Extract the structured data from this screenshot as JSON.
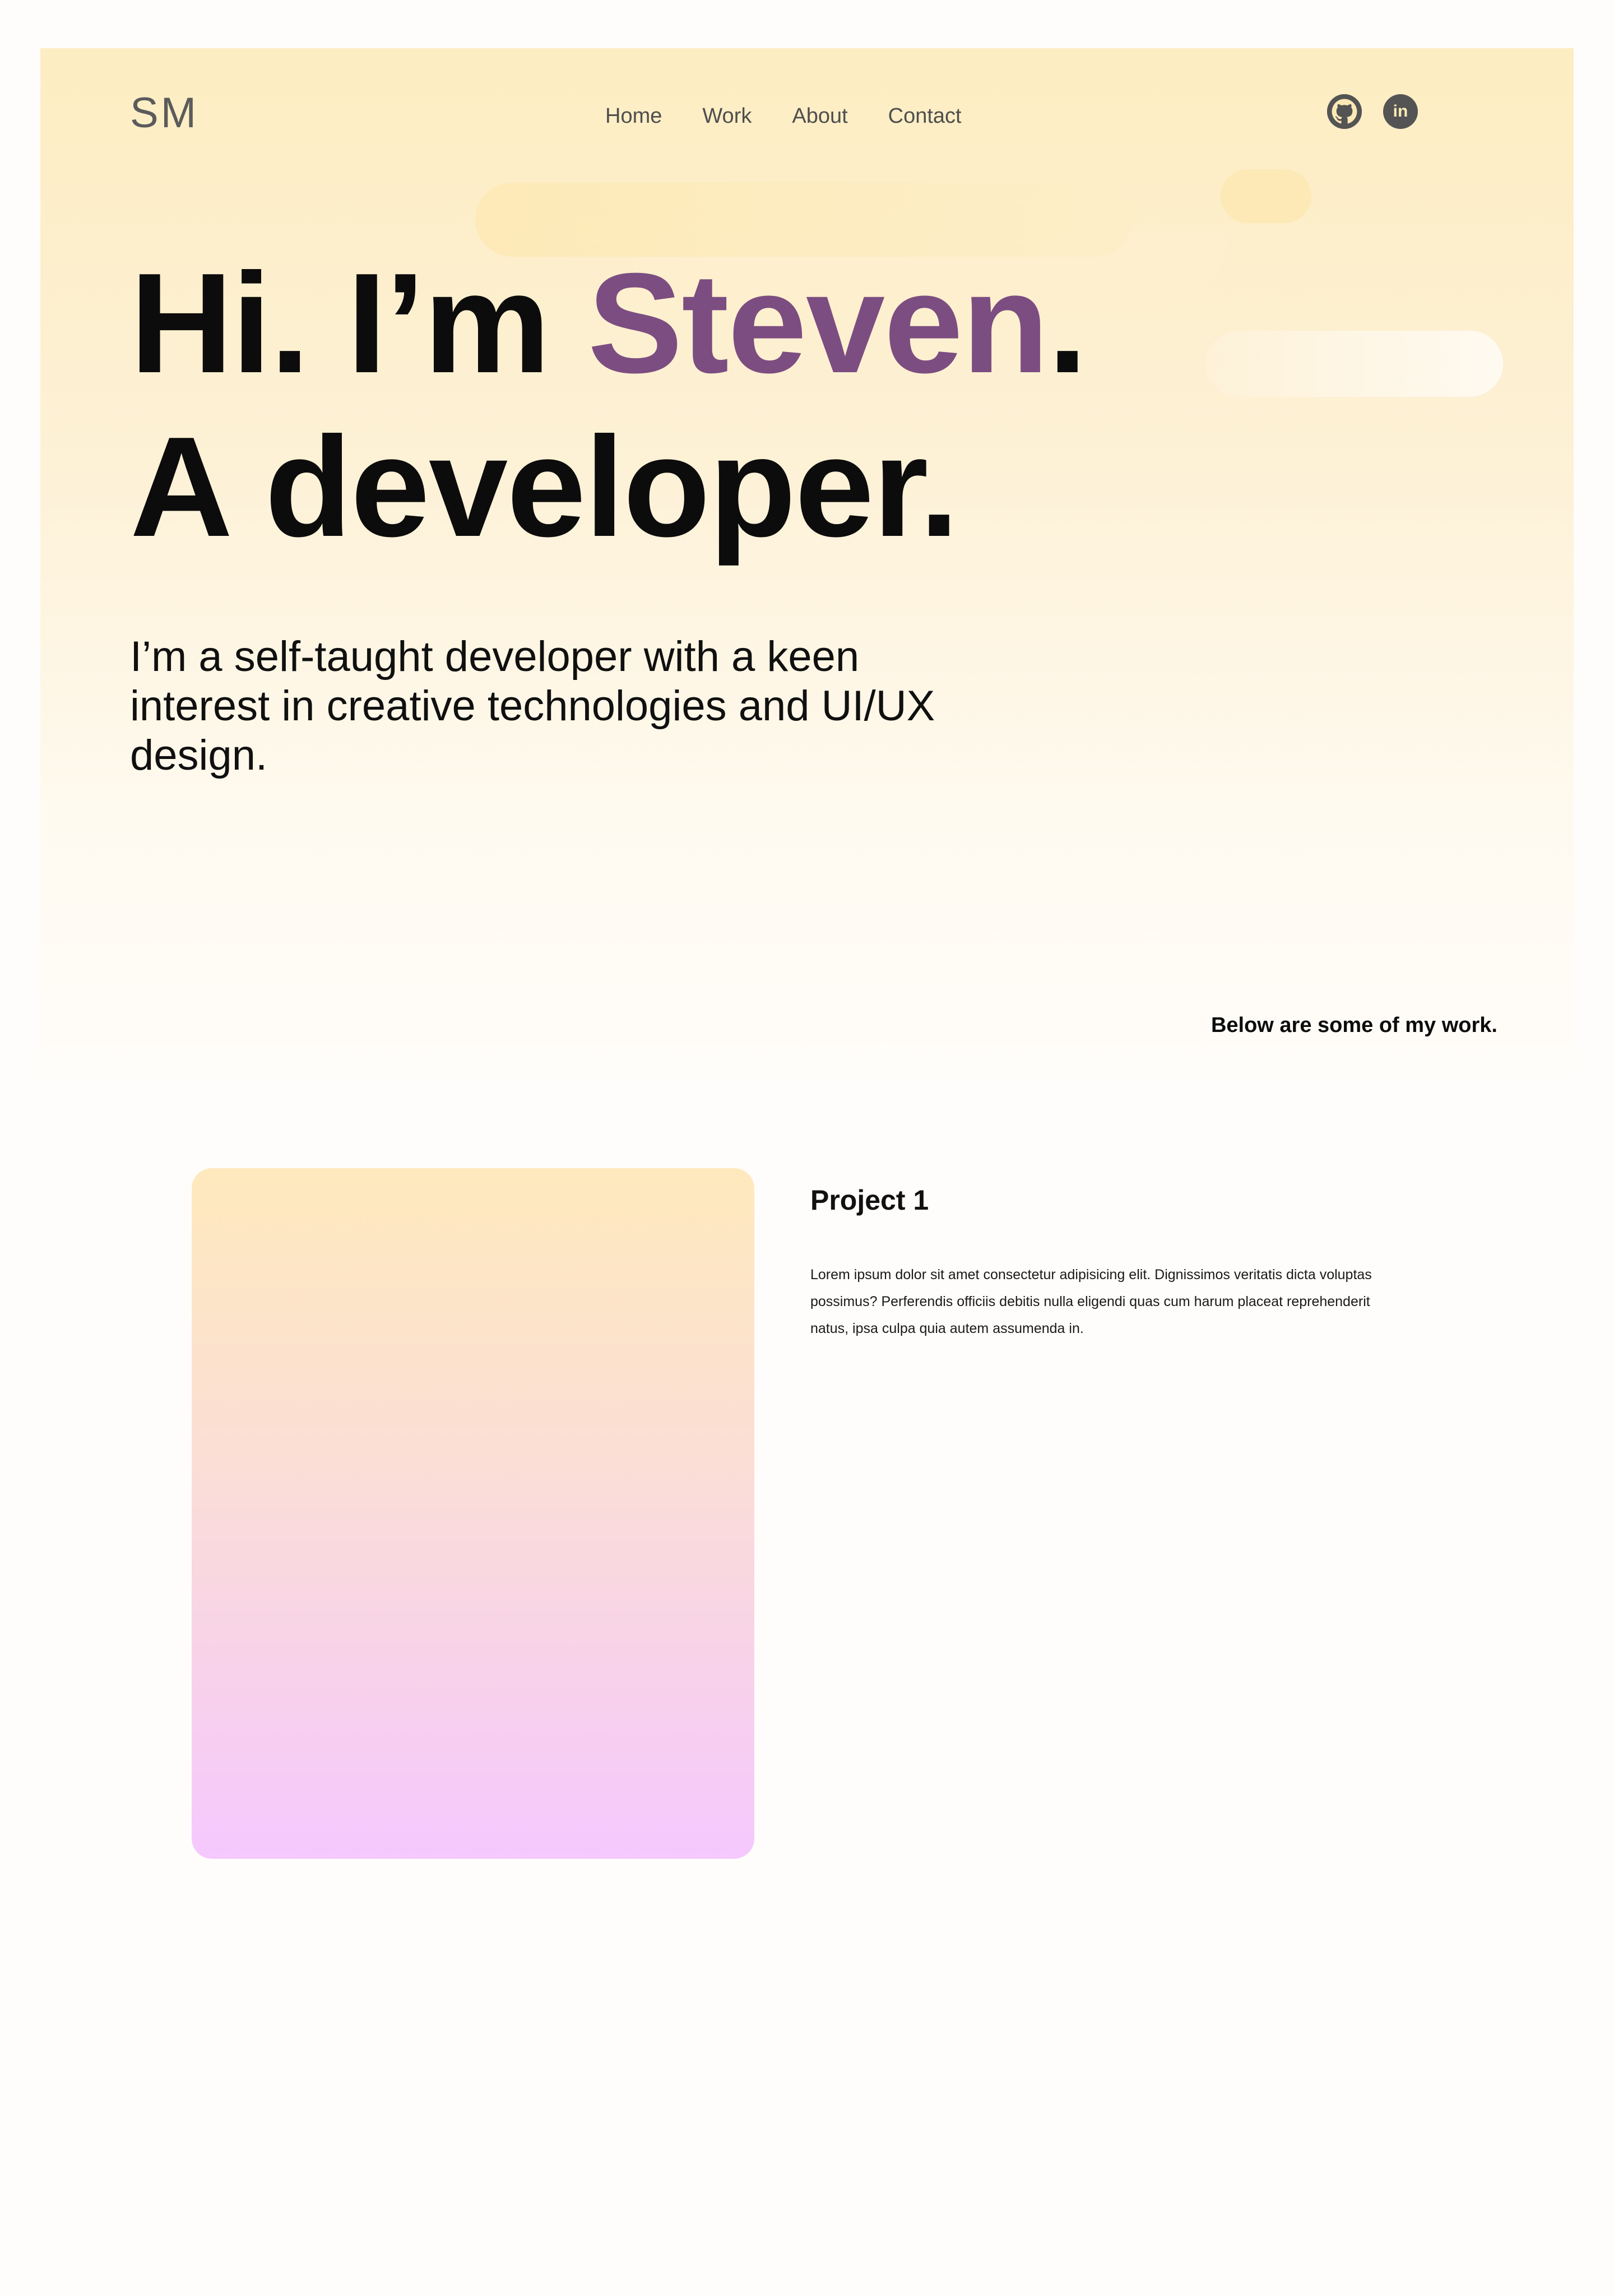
{
  "header": {
    "logo": "SM",
    "nav": [
      "Home",
      "Work",
      "About",
      "Contact"
    ],
    "social": {
      "github_icon": "github-icon",
      "linkedin_icon": "linkedin-icon",
      "linkedin_text": "in"
    }
  },
  "hero": {
    "greeting": "Hi. I’m ",
    "name": "Steven",
    "greeting_end": ".",
    "role": "A developer.",
    "intro": "I’m a self-taught developer with a keen interest in creative technologies and UI/UX design.",
    "work_note": "Below are some of my work."
  },
  "projects": [
    {
      "title": "Project 1",
      "description": "Lorem ipsum dolor sit amet consectetur adipisicing elit. Dignissimos veritatis dicta voluptas possimus? Perferendis officiis debitis nulla eligendi quas cum harum placeat reprehenderit natus, ipsa culpa quia autem assumenda in."
    }
  ],
  "colors": {
    "accent": "#7c4d81",
    "hero_bg_top": "#fdedc2",
    "text": "#0c0c0c",
    "icon": "#545454",
    "project_gradient_top": "#fee9bd",
    "project_gradient_bottom": "#f5c8fe"
  }
}
